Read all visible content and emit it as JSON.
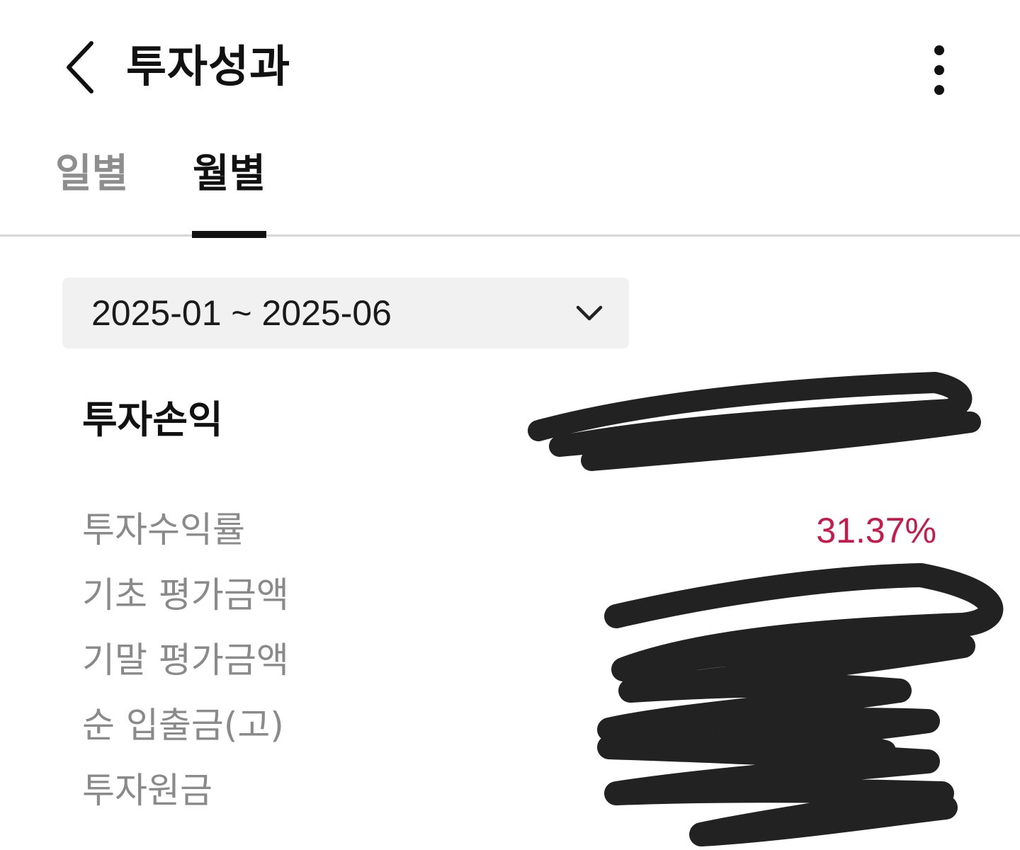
{
  "header": {
    "title": "투자성과",
    "back_icon": "chevron-left-icon",
    "more_icon": "more-vertical-icon"
  },
  "tabs": [
    {
      "label": "일별",
      "active": false
    },
    {
      "label": "월별",
      "active": true
    }
  ],
  "period": {
    "value": "2025-01 ~ 2025-06",
    "dropdown_icon": "chevron-down-icon"
  },
  "summary": {
    "profit_label": "투자손익",
    "rows": [
      {
        "label": "투자수익률",
        "value": "31.37%"
      },
      {
        "label": "기초 평가금액"
      },
      {
        "label": "기말 평가금액"
      },
      {
        "label": "순 입출금(고)"
      },
      {
        "label": "투자원금"
      }
    ]
  },
  "colors": {
    "positive": "#c8194a",
    "active_tab": "#111111",
    "inactive_tab": "#8e8e8e",
    "select_bg": "#f1f1f1",
    "redaction": "#222222"
  }
}
